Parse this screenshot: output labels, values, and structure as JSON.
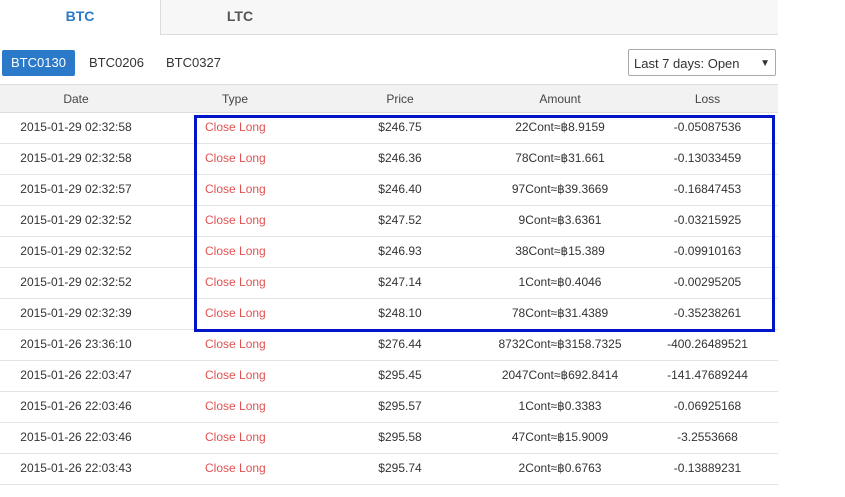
{
  "tabs": [
    "BTC",
    "LTC"
  ],
  "contracts": [
    "BTC0130",
    "BTC0206",
    "BTC0327"
  ],
  "filter": {
    "selected": "Last 7 days: Open",
    "arrow_icon": "caret-down-icon"
  },
  "table": {
    "headers": [
      "Date",
      "Type",
      "Price",
      "Amount",
      "Loss"
    ],
    "rows": [
      {
        "date": "2015-01-29 02:32:58",
        "type": "Close Long",
        "price": "$246.75",
        "amount": "22Cont≈฿8.9159",
        "loss": "-0.05087536"
      },
      {
        "date": "2015-01-29 02:32:58",
        "type": "Close Long",
        "price": "$246.36",
        "amount": "78Cont≈฿31.661",
        "loss": "-0.13033459"
      },
      {
        "date": "2015-01-29 02:32:57",
        "type": "Close Long",
        "price": "$246.40",
        "amount": "97Cont≈฿39.3669",
        "loss": "-0.16847453"
      },
      {
        "date": "2015-01-29 02:32:52",
        "type": "Close Long",
        "price": "$247.52",
        "amount": "9Cont≈฿3.6361",
        "loss": "-0.03215925"
      },
      {
        "date": "2015-01-29 02:32:52",
        "type": "Close Long",
        "price": "$246.93",
        "amount": "38Cont≈฿15.389",
        "loss": "-0.09910163"
      },
      {
        "date": "2015-01-29 02:32:52",
        "type": "Close Long",
        "price": "$247.14",
        "amount": "1Cont≈฿0.4046",
        "loss": "-0.00295205"
      },
      {
        "date": "2015-01-29 02:32:39",
        "type": "Close Long",
        "price": "$248.10",
        "amount": "78Cont≈฿31.4389",
        "loss": "-0.35238261"
      },
      {
        "date": "2015-01-26 23:36:10",
        "type": "Close Long",
        "price": "$276.44",
        "amount": "8732Cont≈฿3158.7325",
        "loss": "-400.26489521"
      },
      {
        "date": "2015-01-26 22:03:47",
        "type": "Close Long",
        "price": "$295.45",
        "amount": "2047Cont≈฿692.8414",
        "loss": "-141.47689244"
      },
      {
        "date": "2015-01-26 22:03:46",
        "type": "Close Long",
        "price": "$295.57",
        "amount": "1Cont≈฿0.3383",
        "loss": "-0.06925168"
      },
      {
        "date": "2015-01-26 22:03:46",
        "type": "Close Long",
        "price": "$295.58",
        "amount": "47Cont≈฿15.9009",
        "loss": "-3.2553668"
      },
      {
        "date": "2015-01-26 22:03:43",
        "type": "Close Long",
        "price": "$295.74",
        "amount": "2Cont≈฿0.6763",
        "loss": "-0.13889231"
      }
    ]
  },
  "colors": {
    "accent": "#2a7ac9",
    "close_long": "#e05252",
    "highlight": "#0015c8"
  }
}
